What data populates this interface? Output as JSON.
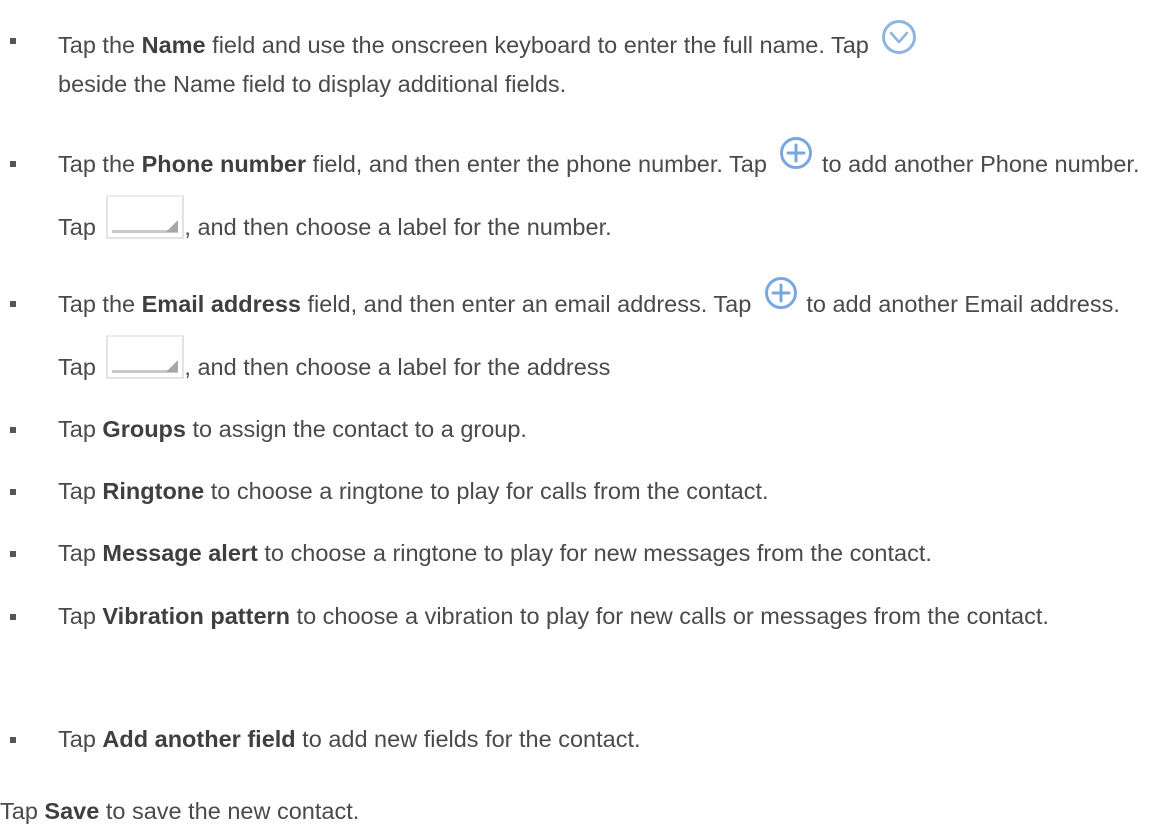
{
  "items": [
    {
      "pre": "Tap the ",
      "bold": "Name",
      "post": " field and use the onscreen keyboard to enter the full name. Tap ",
      "post2": "beside the Name field to display additional fields.",
      "icon": "chevron-circle-icon"
    },
    {
      "pre": "Tap the ",
      "bold": "Phone number",
      "post": " field, and then enter the phone number. Tap ",
      "mid": " to add another Phone number. Tap ",
      "end": ", and then choose a label for the number.",
      "icon": "plus-circle-icon"
    },
    {
      "pre": "Tap the ",
      "bold": "Email address",
      "post": " field, and then enter an email address. Tap ",
      "mid": " to add another Email address. Tap ",
      "end": ", and then choose a label for the address",
      "icon": "plus-circle-icon"
    },
    {
      "pre": "Tap ",
      "bold": "Groups",
      "post": " to assign the contact to a group."
    },
    {
      "pre": "Tap ",
      "bold": "Ringtone",
      "post": " to choose a ringtone to play for calls from the contact."
    },
    {
      "pre": "Tap ",
      "bold": "Message alert",
      "post": " to choose a ringtone to play for new messages from the contact."
    },
    {
      "pre": "Tap ",
      "bold": "Vibration pattern",
      "post": " to choose a vibration to play for new calls or messages from the contact."
    },
    {
      "pre": "Tap ",
      "bold": "Add another field",
      "post": " to add new fields for the contact."
    }
  ],
  "footer": {
    "pre": "Tap ",
    "bold": "Save",
    "post": " to save the new contact."
  },
  "colors": {
    "text": "#4a4a4a",
    "icon_blue": "#6fa0d8",
    "bullet": "#555555"
  }
}
